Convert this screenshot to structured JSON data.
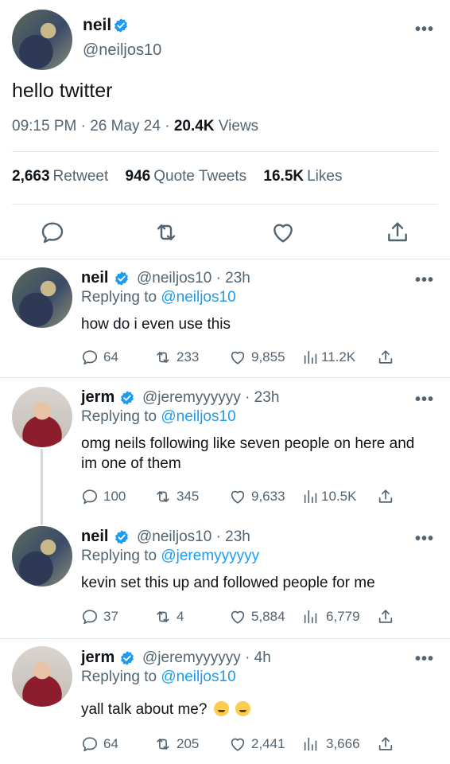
{
  "accent_color": "#1d9bf0",
  "main_tweet": {
    "name": "neil",
    "handle": "@neiljos10",
    "text": "hello twitter",
    "time": "09:15 PM",
    "date": "26 May 24",
    "views_count": "20.4K",
    "views_label": "Views",
    "retweets_count": "2,663",
    "retweets_label": "Retweet",
    "quotes_count": "946",
    "quotes_label": "Quote Tweets",
    "likes_count": "16.5K",
    "likes_label": "Likes",
    "more": "•••"
  },
  "replies": [
    {
      "name": "neil",
      "handle_time": "@neiljos10 · 23h",
      "replying_label": "Replying to",
      "replying_to": "@neiljos10",
      "text": "how do i even use this",
      "comments": "64",
      "retweets": "233",
      "likes": "9,855",
      "views": "11.2K"
    },
    {
      "name": "jerm",
      "handle_time": "@jeremyyyyyy · 23h",
      "replying_label": "Replying to",
      "replying_to": "@neiljos10",
      "text": "omg neils following like seven people on here and im one of them",
      "comments": "100",
      "retweets": "345",
      "likes": "9,633",
      "views": "10.5K"
    },
    {
      "name": "neil",
      "handle_time": "@neiljos10 · 23h",
      "replying_label": "Replying to",
      "replying_to": "@jeremyyyyyy",
      "text": "kevin set this up and followed people for me",
      "comments": "37",
      "retweets": "4",
      "likes": "5,884",
      "views": "6,779"
    },
    {
      "name": "jerm",
      "handle_time": "@jeremyyyyyy · 4h",
      "replying_label": "Replying to",
      "replying_to": "@neiljos10",
      "text": "yall talk about me?",
      "comments": "64",
      "retweets": "205",
      "likes": "2,441",
      "views": "3,666"
    }
  ]
}
